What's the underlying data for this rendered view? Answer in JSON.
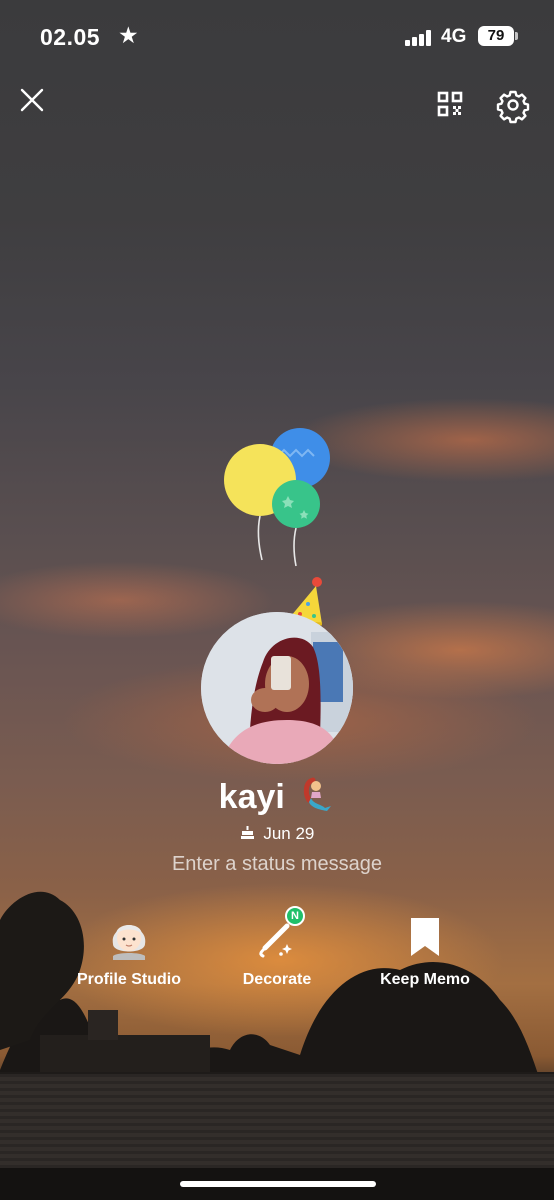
{
  "status_bar": {
    "time": "02.05",
    "network": "4G",
    "battery": "79"
  },
  "profile": {
    "name": "kayi",
    "birthday": "Jun 29",
    "status_placeholder": "Enter a status message"
  },
  "actions": [
    {
      "label": "Profile Studio",
      "icon": "avatar-face-icon"
    },
    {
      "label": "Decorate",
      "icon": "magic-wand-icon",
      "badge": "N"
    },
    {
      "label": "Keep Memo",
      "icon": "bookmark-icon"
    }
  ],
  "colors": {
    "badge_green": "#1fc06a",
    "balloon_yellow": "#f5e35a",
    "balloon_blue": "#3f8ee8",
    "balloon_green": "#38c48a"
  }
}
